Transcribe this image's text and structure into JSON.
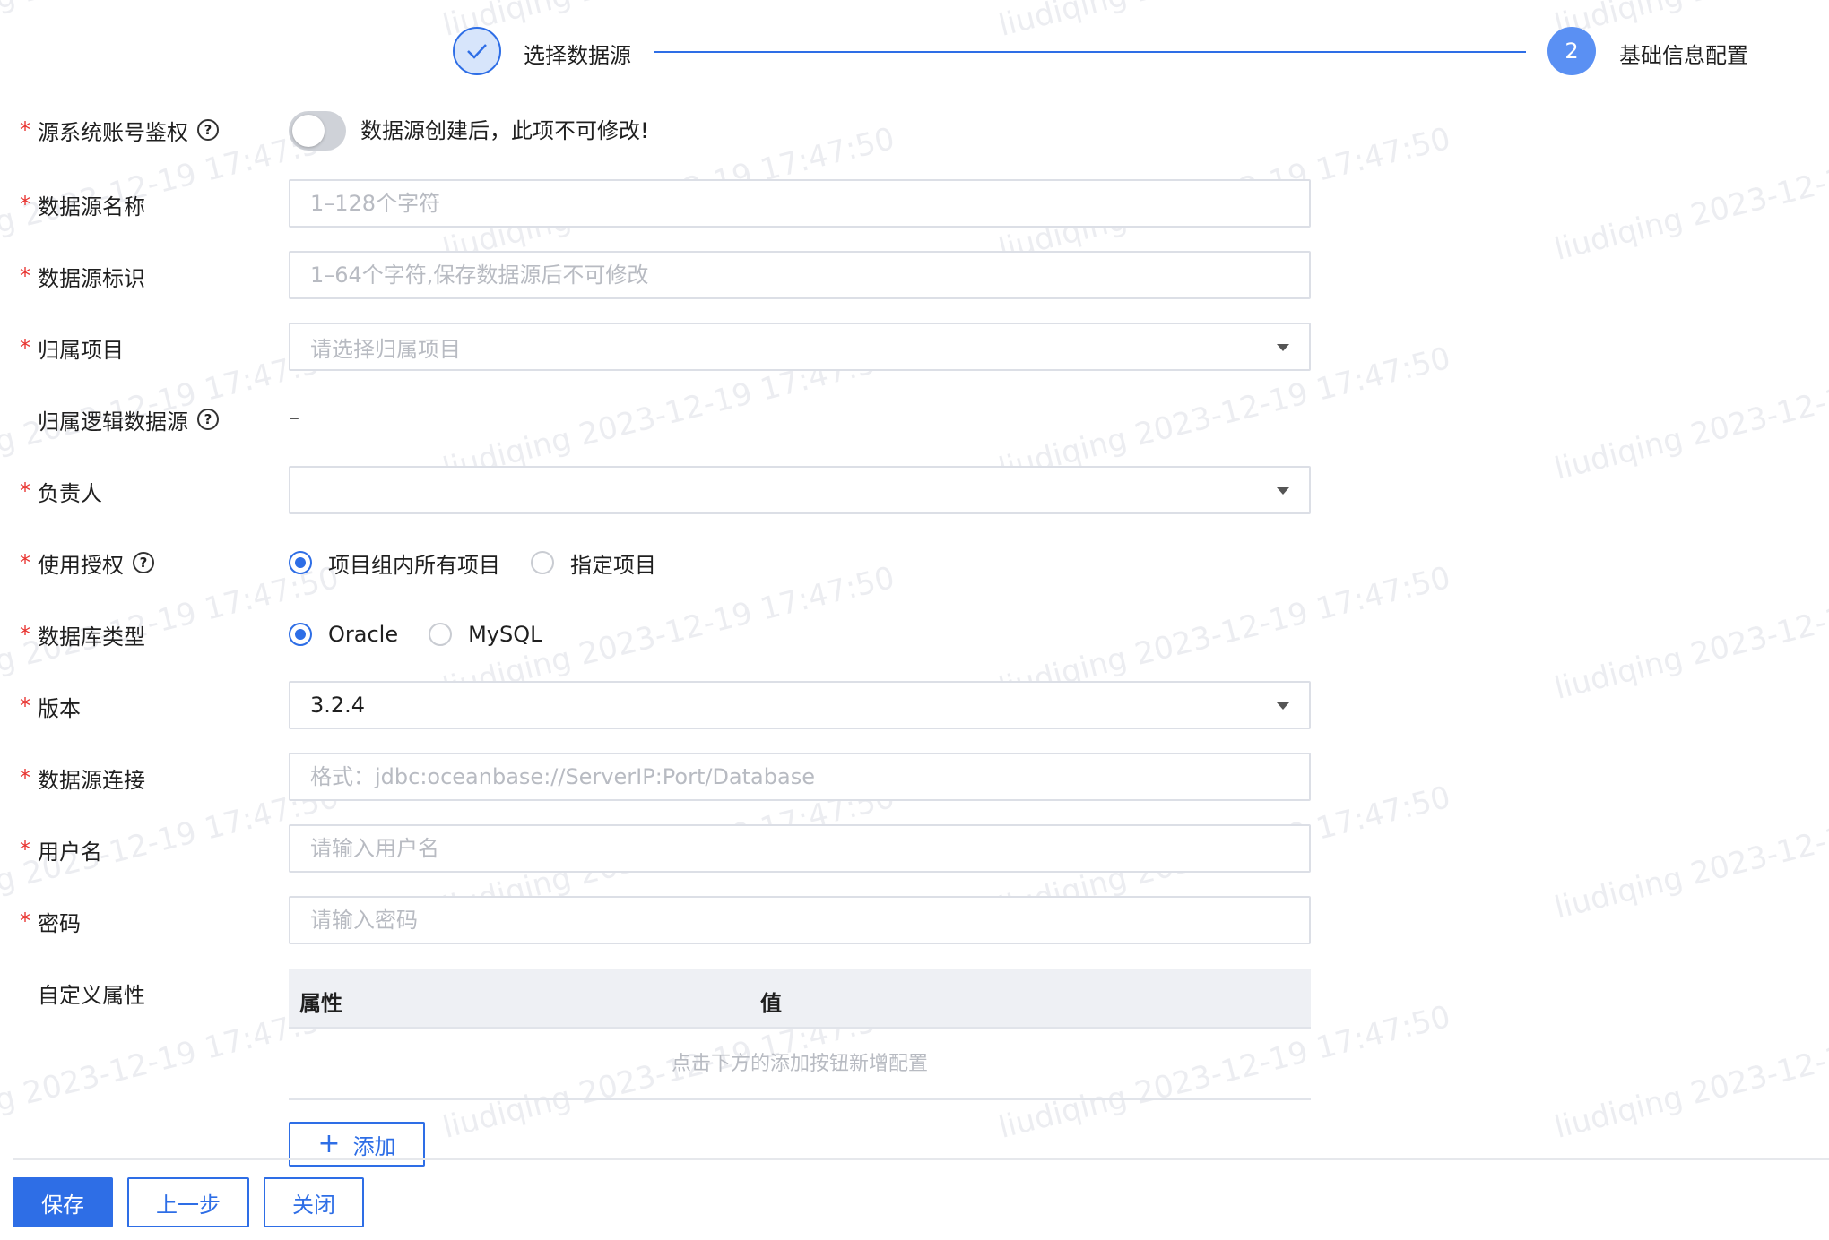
{
  "watermark": {
    "texts": [
      "liudiqing 2023-12-19 17:47:50"
    ]
  },
  "steps": [
    {
      "label": "选择数据源",
      "state": "done"
    },
    {
      "number": "2",
      "label": "基础信息配置",
      "state": "current"
    }
  ],
  "form": {
    "auth": {
      "label": "源系统账号鉴权",
      "note": "数据源创建后，此项不可修改!"
    },
    "name": {
      "label": "数据源名称",
      "placeholder": "1–128个字符"
    },
    "identifier": {
      "label": "数据源标识",
      "placeholder": "1–64个字符,保存数据源后不可修改"
    },
    "project": {
      "label": "归属项目",
      "placeholder": "请选择归属项目"
    },
    "logical_source": {
      "label": "归属逻辑数据源",
      "value": "–"
    },
    "owner": {
      "label": "负责人",
      "value": ""
    },
    "usage_auth": {
      "label": "使用授权",
      "options": [
        "项目组内所有项目",
        "指定项目"
      ],
      "selected": "项目组内所有项目"
    },
    "db_type": {
      "label": "数据库类型",
      "options": [
        "Oracle",
        "MySQL"
      ],
      "selected": "Oracle"
    },
    "version": {
      "label": "版本",
      "value": "3.2.4"
    },
    "connection": {
      "label": "数据源连接",
      "placeholder": "格式：jdbc:oceanbase://ServerIP:Port/Database"
    },
    "username": {
      "label": "用户名",
      "placeholder": "请输入用户名"
    },
    "password": {
      "label": "密码",
      "placeholder": "请输入密码"
    },
    "custom_props": {
      "label": "自定义属性",
      "columns": [
        "属性",
        "值"
      ],
      "empty_text": "点击下方的添加按钮新增配置",
      "add_label": "添加"
    }
  },
  "footer": {
    "save": "保存",
    "prev": "上一步",
    "close": "关闭"
  },
  "colors": {
    "primary": "#2e6ee6",
    "required": "#e8332f"
  }
}
